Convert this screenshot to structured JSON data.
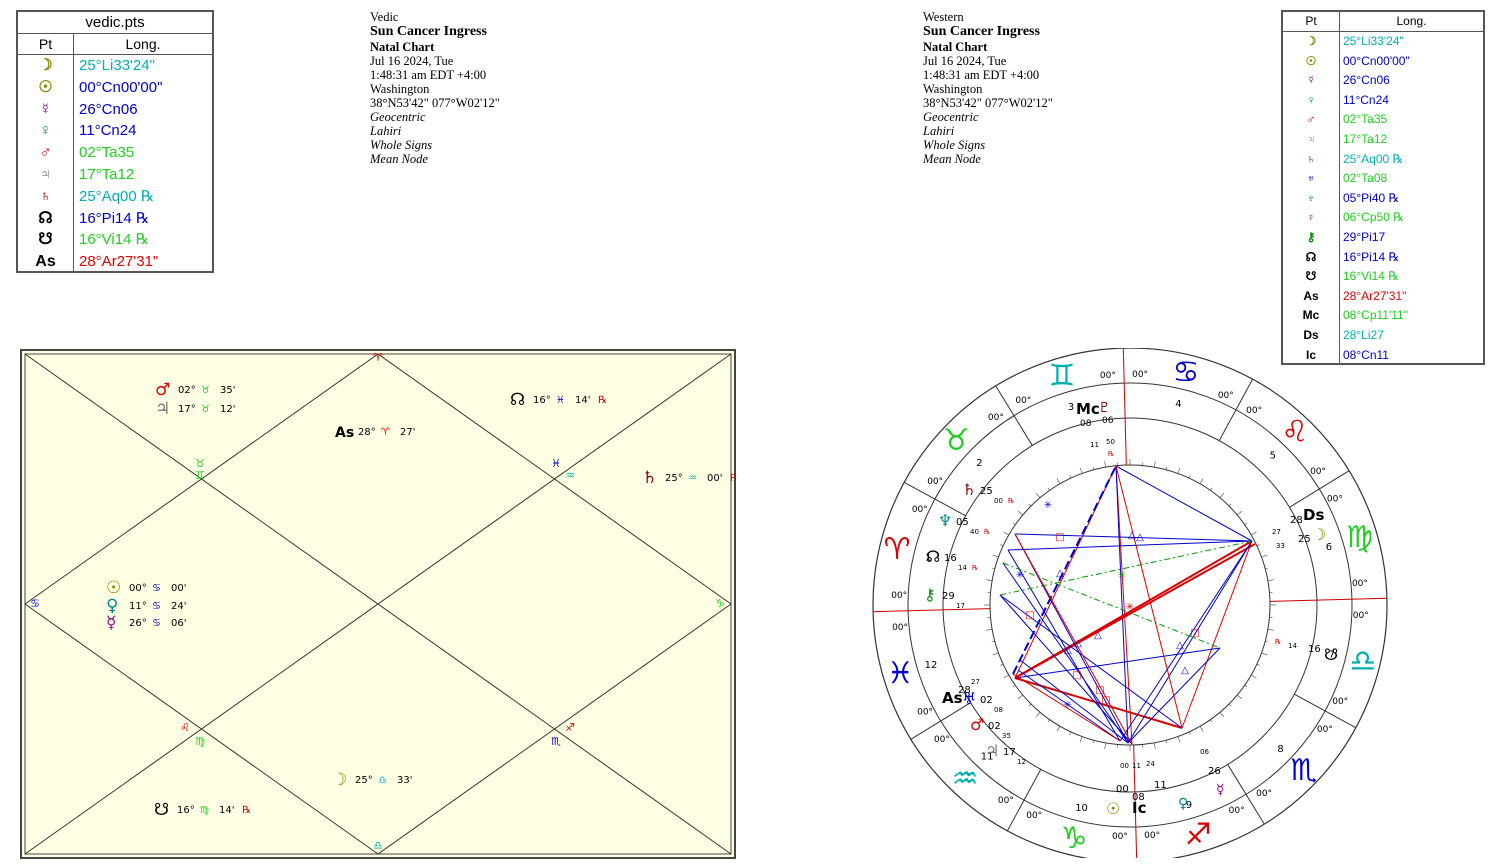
{
  "vedic_table": {
    "title": "vedic.pts",
    "col_pt": "Pt",
    "col_long": "Long.",
    "rows": [
      {
        "glyph": "☽",
        "value": "25°Li33'24\"",
        "color": "#00b0b0",
        "gcolor": "#8a8a00"
      },
      {
        "glyph": "☉",
        "value": "00°Cn00'00\"",
        "color": "#0000cc",
        "gcolor": "#8a8a00"
      },
      {
        "glyph": "☿",
        "value": "26°Cn06",
        "color": "#0000cc",
        "gcolor": "#880088"
      },
      {
        "glyph": "♀",
        "value": "11°Cn24",
        "color": "#0000cc",
        "gcolor": "#008888"
      },
      {
        "glyph": "♂",
        "value": "02°Ta35",
        "color": "#22cc22",
        "gcolor": "#dd0000"
      },
      {
        "glyph": "♃",
        "value": "17°Ta12",
        "color": "#22cc22",
        "gcolor": "#777777"
      },
      {
        "glyph": "♄",
        "value": "25°Aq00 ℞",
        "color": "#00b0b0",
        "gcolor": "#880000"
      },
      {
        "glyph": "☊",
        "value": "16°Pi14 ℞",
        "color": "#0000cc",
        "gcolor": "#000000"
      },
      {
        "glyph": "☋",
        "value": "16°Vi14 ℞",
        "color": "#22cc22",
        "gcolor": "#000000"
      },
      {
        "glyph": "As",
        "value": "28°Ar27'31\"",
        "color": "#dd0000",
        "gcolor": "#000000"
      }
    ]
  },
  "vedic_info": {
    "system": "Vedic",
    "title": "Sun Cancer Ingress",
    "chart_type": "Natal Chart",
    "date": "Jul 16 2024, Tue",
    "time": "1:48:31 am  EDT +4:00",
    "place": "Washington",
    "coords": "38°N53'42\" 077°W02'12\"",
    "geo": "Geocentric",
    "ayanamsa": "Lahiri",
    "houses": "Whole Signs",
    "node": "Mean Node"
  },
  "western_info": {
    "system": "Western",
    "title": "Sun Cancer Ingress",
    "chart_type": "Natal Chart",
    "date": "Jul 16 2024, Tue",
    "time": "1:48:31 am  EDT +4:00",
    "place": "Washington",
    "coords": "38°N53'42\" 077°W02'12\"",
    "geo": "Geocentric",
    "ayanamsa": "Lahiri",
    "houses": "Whole Signs",
    "node": "Mean Node"
  },
  "western_table": {
    "col_pt": "Pt",
    "col_long": "Long.",
    "rows": [
      {
        "glyph": "☽",
        "value": "25°Li33'24\"",
        "color": "#00b0b0",
        "gcolor": "#8a8a00"
      },
      {
        "glyph": "☉",
        "value": "00°Cn00'00\"",
        "color": "#0000cc",
        "gcolor": "#8a8a00"
      },
      {
        "glyph": "☿",
        "value": "26°Cn06",
        "color": "#0000cc",
        "gcolor": "#880088"
      },
      {
        "glyph": "♀",
        "value": "11°Cn24",
        "color": "#0000cc",
        "gcolor": "#008888"
      },
      {
        "glyph": "♂",
        "value": "02°Ta35",
        "color": "#22cc22",
        "gcolor": "#dd0000"
      },
      {
        "glyph": "♃",
        "value": "17°Ta12",
        "color": "#22cc22",
        "gcolor": "#777777"
      },
      {
        "glyph": "♄",
        "value": "25°Aq00 ℞",
        "color": "#00b0b0",
        "gcolor": "#880000"
      },
      {
        "glyph": "♅",
        "value": "02°Ta08",
        "color": "#22cc22",
        "gcolor": "#0000cc"
      },
      {
        "glyph": "♆",
        "value": "05°Pi40 ℞",
        "color": "#0000cc",
        "gcolor": "#008888"
      },
      {
        "glyph": "♇",
        "value": "06°Cp50 ℞",
        "color": "#22cc22",
        "gcolor": "#880000"
      },
      {
        "glyph": "⚷",
        "value": "29°Pi17",
        "color": "#0000cc",
        "gcolor": "#008800"
      },
      {
        "glyph": "☊",
        "value": "16°Pi14 ℞",
        "color": "#0000cc",
        "gcolor": "#000000"
      },
      {
        "glyph": "☋",
        "value": "16°Vi14 ℞",
        "color": "#22cc22",
        "gcolor": "#000000"
      },
      {
        "glyph": "As",
        "value": "28°Ar27'31\"",
        "color": "#dd0000",
        "gcolor": "#000000"
      },
      {
        "glyph": "Mc",
        "value": "08°Cp11'11\"",
        "color": "#22cc22",
        "gcolor": "#000000"
      },
      {
        "glyph": "Ds",
        "value": "28°Li27",
        "color": "#00b0b0",
        "gcolor": "#000000"
      },
      {
        "glyph": "Ic",
        "value": "08°Cn11",
        "color": "#0000cc",
        "gcolor": "#000000"
      }
    ]
  },
  "north_chart": {
    "sign_glyphs": {
      "aries": "♈",
      "taurus": "♉",
      "gemini": "♊",
      "cancer": "♋",
      "leo": "♌",
      "virgo": "♍",
      "libra": "♎",
      "scorpio": "♏",
      "sagittarius": "♐",
      "capricorn": "♑",
      "aquarius": "♒",
      "pisces": "♓"
    },
    "placements": [
      {
        "id": "mars",
        "glyph": "♂",
        "gcolor": "#dd0000",
        "deg": "02°",
        "sign": "♉",
        "scolor": "#22cc22",
        "min": "35'",
        "rx": ""
      },
      {
        "id": "jupiter",
        "glyph": "♃",
        "gcolor": "#777777",
        "deg": "17°",
        "sign": "♉",
        "scolor": "#22cc22",
        "min": "12'",
        "rx": ""
      },
      {
        "id": "asc",
        "glyph": "As",
        "gcolor": "#000000",
        "deg": "28°",
        "sign": "♈",
        "scolor": "#dd0000",
        "min": "27'",
        "rx": ""
      },
      {
        "id": "node",
        "glyph": "☊",
        "gcolor": "#000000",
        "deg": "16°",
        "sign": "♓",
        "scolor": "#0000cc",
        "min": "14'",
        "rx": "℞"
      },
      {
        "id": "saturn",
        "glyph": "♄",
        "gcolor": "#880000",
        "deg": "25°",
        "sign": "♒",
        "scolor": "#00b0b0",
        "min": "00'",
        "rx": "℞"
      },
      {
        "id": "sun",
        "glyph": "☉",
        "gcolor": "#8a8a00",
        "deg": "00°",
        "sign": "♋",
        "scolor": "#0000cc",
        "min": "00'",
        "rx": ""
      },
      {
        "id": "venus",
        "glyph": "♀",
        "gcolor": "#008888",
        "deg": "11°",
        "sign": "♋",
        "scolor": "#0000cc",
        "min": "24'",
        "rx": ""
      },
      {
        "id": "mercury",
        "glyph": "☿",
        "gcolor": "#880088",
        "deg": "26°",
        "sign": "♋",
        "scolor": "#0000cc",
        "min": "06'",
        "rx": ""
      },
      {
        "id": "moon",
        "glyph": "☽",
        "gcolor": "#8a8a00",
        "deg": "25°",
        "sign": "♎",
        "scolor": "#00b0b0",
        "min": "33'",
        "rx": ""
      },
      {
        "id": "ketu",
        "glyph": "☋",
        "gcolor": "#000000",
        "deg": "16°",
        "sign": "♍",
        "scolor": "#22cc22",
        "min": "14'",
        "rx": "℞"
      }
    ]
  },
  "wheel": {
    "house_numbers": [
      "1",
      "2",
      "3",
      "4",
      "5",
      "6",
      "7",
      "8",
      "9",
      "10",
      "11",
      "12"
    ],
    "cusp_label": "00°",
    "angles": {
      "asc": "As",
      "mc": "Mc",
      "ds": "Ds",
      "ic": "Ic"
    },
    "asc_text": {
      "deg": "28",
      "min": "27"
    },
    "mc_text": {
      "deg": "08",
      "min": "11",
      "deg2": "06",
      "min2": "50"
    },
    "ds_text": {
      "deg": "28",
      "min": "27"
    },
    "ic_text": {
      "deg": "08",
      "min": "11"
    },
    "labels": {
      "moon": {
        "deg": "25",
        "min": "33"
      },
      "saturn": {
        "deg": "25",
        "min": "00"
      },
      "neptune": {
        "deg": "05",
        "min": "40"
      },
      "node": {
        "deg": "16",
        "min": "14"
      },
      "chiron": {
        "deg": "29",
        "min": "17"
      },
      "mars": {
        "deg": "02",
        "min": "35"
      },
      "uranus": {
        "deg": "02",
        "min": "08"
      },
      "jupiter": {
        "deg": "17",
        "min": "12"
      },
      "ketu": {
        "deg": "16",
        "min": "14"
      },
      "sun": {
        "deg": "00",
        "min": "00"
      },
      "venus": {
        "deg": "11",
        "min": "24"
      },
      "mercury": {
        "deg": "26",
        "min": "06"
      }
    },
    "rx": "℞"
  }
}
